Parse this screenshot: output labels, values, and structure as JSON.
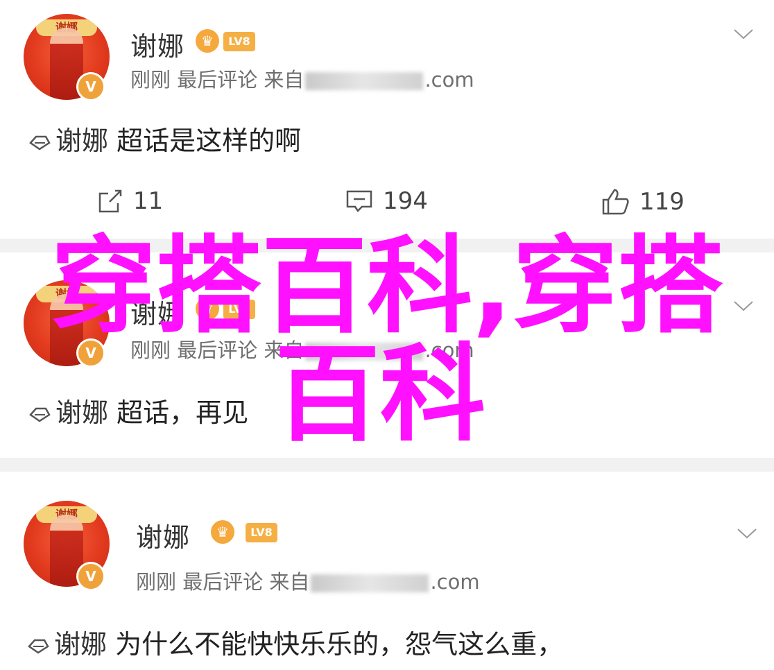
{
  "posts": [
    {
      "avatar_tag": "谢娜",
      "username": "谢娜",
      "crown": "♛",
      "level": "LV8",
      "meta_prefix": "刚刚 最后评论  来自",
      "meta_suffix": ".com",
      "content_topic": "谢娜",
      "content_text": "超话是这样的啊",
      "repost_count": "11",
      "comment_count": "194",
      "like_count": "119"
    },
    {
      "avatar_tag": "谢娜",
      "username": "谢娜",
      "crown": "♛",
      "level": "LV8",
      "meta_prefix": "刚刚 最后评论  来自",
      "meta_suffix": ".com",
      "content_topic": "谢娜",
      "content_text": "超话，再见"
    },
    {
      "avatar_tag": "谢娜",
      "username": "谢娜",
      "crown": "♛",
      "level": "LV8",
      "meta_prefix": "刚刚 最后评论  来自",
      "meta_suffix": ".com",
      "content_topic": "谢娜",
      "content_text": "为什么不能快快乐乐的，怨气这么重，"
    }
  ],
  "overlay": {
    "line1": "穿搭百科,穿搭",
    "line2": "百科",
    "color": "#ff10ff"
  },
  "icons": {
    "repost": "repost-icon",
    "comment": "comment-icon",
    "like": "thumbs-up-icon",
    "chevron": "chevron-down-icon",
    "topic": "diamond-topic-icon",
    "verify": "verified-badge-icon"
  }
}
